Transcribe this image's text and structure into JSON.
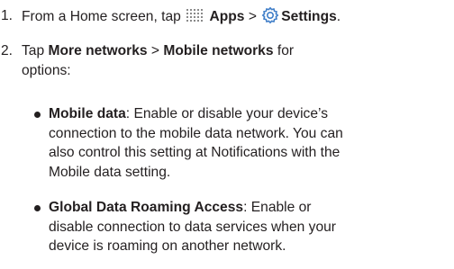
{
  "steps": [
    {
      "number": "1.",
      "prefix": "From a Home screen, tap",
      "apps_label": "Apps",
      "separator": ">",
      "settings_label": "Settings",
      "suffix": "."
    },
    {
      "number": "2.",
      "prefix": "Tap",
      "more_networks_label": "More networks",
      "separator": ">",
      "mobile_networks_label": "Mobile networks",
      "suffix": "for",
      "continuation": "options:"
    }
  ],
  "options": [
    {
      "term": "Mobile data",
      "lines": [
        ": Enable or disable your device’s",
        "connection to the mobile data network. You can",
        "also control this setting at Notifications with the",
        "Mobile data setting."
      ]
    },
    {
      "term": "Global Data Roaming Access",
      "lines": [
        ": Enable or",
        "disable connection to data services when your",
        "device is roaming on another network."
      ]
    }
  ],
  "icons": {
    "apps": "apps-grid-icon",
    "settings": "gear-icon",
    "settings_color": "#3f7ec8"
  }
}
